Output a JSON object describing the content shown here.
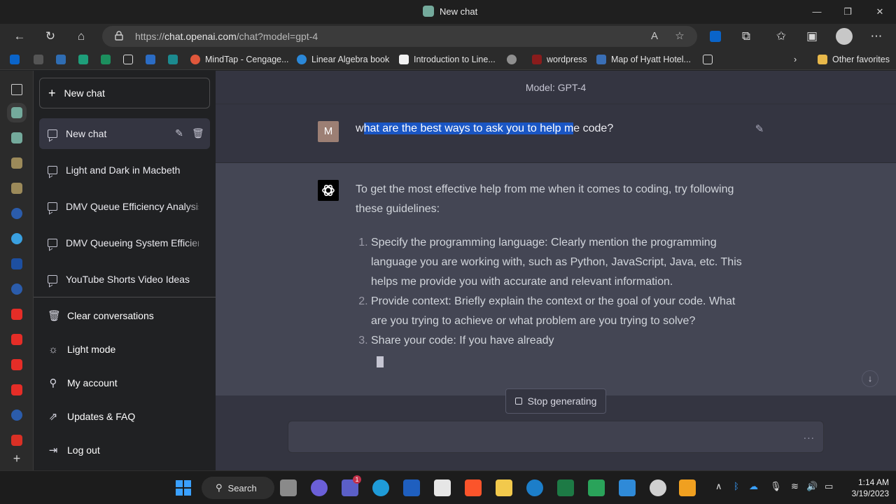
{
  "window": {
    "title": "New chat"
  },
  "browser": {
    "url_prefix": "https://",
    "url_host": "chat.openai.com",
    "url_path": "/chat?model=gpt-4"
  },
  "favorites": [
    {
      "label": "MindTap - Cengage...",
      "color": "#e0573b"
    },
    {
      "label": "Linear Algebra book",
      "color": "#2b88d8"
    },
    {
      "label": "Introduction to Line...",
      "color": "#ffffff"
    },
    {
      "label": "wordpress",
      "color": "#8a1c1c"
    },
    {
      "label": "Map of Hyatt Hotel...",
      "color": "#3a6fb5"
    }
  ],
  "favorites_other": "Other favorites",
  "sidebar": {
    "new_chat_label": "New chat",
    "conversations": [
      {
        "label": "New chat"
      },
      {
        "label": "Light and Dark in Macbeth"
      },
      {
        "label": "DMV Queue Efficiency Analysis"
      },
      {
        "label": "DMV Queueing System Efficiency"
      },
      {
        "label": "YouTube Shorts Video Ideas"
      }
    ],
    "menu": [
      {
        "label": "Clear conversations",
        "icon": "trash-icon"
      },
      {
        "label": "Light mode",
        "icon": "sun-icon"
      },
      {
        "label": "My account",
        "icon": "user-icon"
      },
      {
        "label": "Updates & FAQ",
        "icon": "external-link-icon"
      },
      {
        "label": "Log out",
        "icon": "logout-icon"
      }
    ]
  },
  "chat": {
    "model_label": "Model: GPT-4",
    "user_initial": "M",
    "user_message_pre": "w",
    "user_message_selected": "hat are the best ways to ask you to help m",
    "user_message_post": "e code?",
    "assistant_intro": "To get the most effective help from me when it comes to coding, try following these guidelines:",
    "assistant_items": [
      "Specify the programming language: Clearly mention the programming language you are working with, such as Python, JavaScript, Java, etc. This helps me provide you with accurate and relevant information.",
      "Provide context: Briefly explain the context or the goal of your code. What are you trying to achieve or what problem are you trying to solve?",
      "Share your code: If you have already"
    ],
    "stop_label": "Stop generating",
    "input_dots": "..."
  },
  "taskbar": {
    "search_label": "Search",
    "teams_badge": "1",
    "time": "1:14 AM",
    "date": "3/19/2023"
  }
}
